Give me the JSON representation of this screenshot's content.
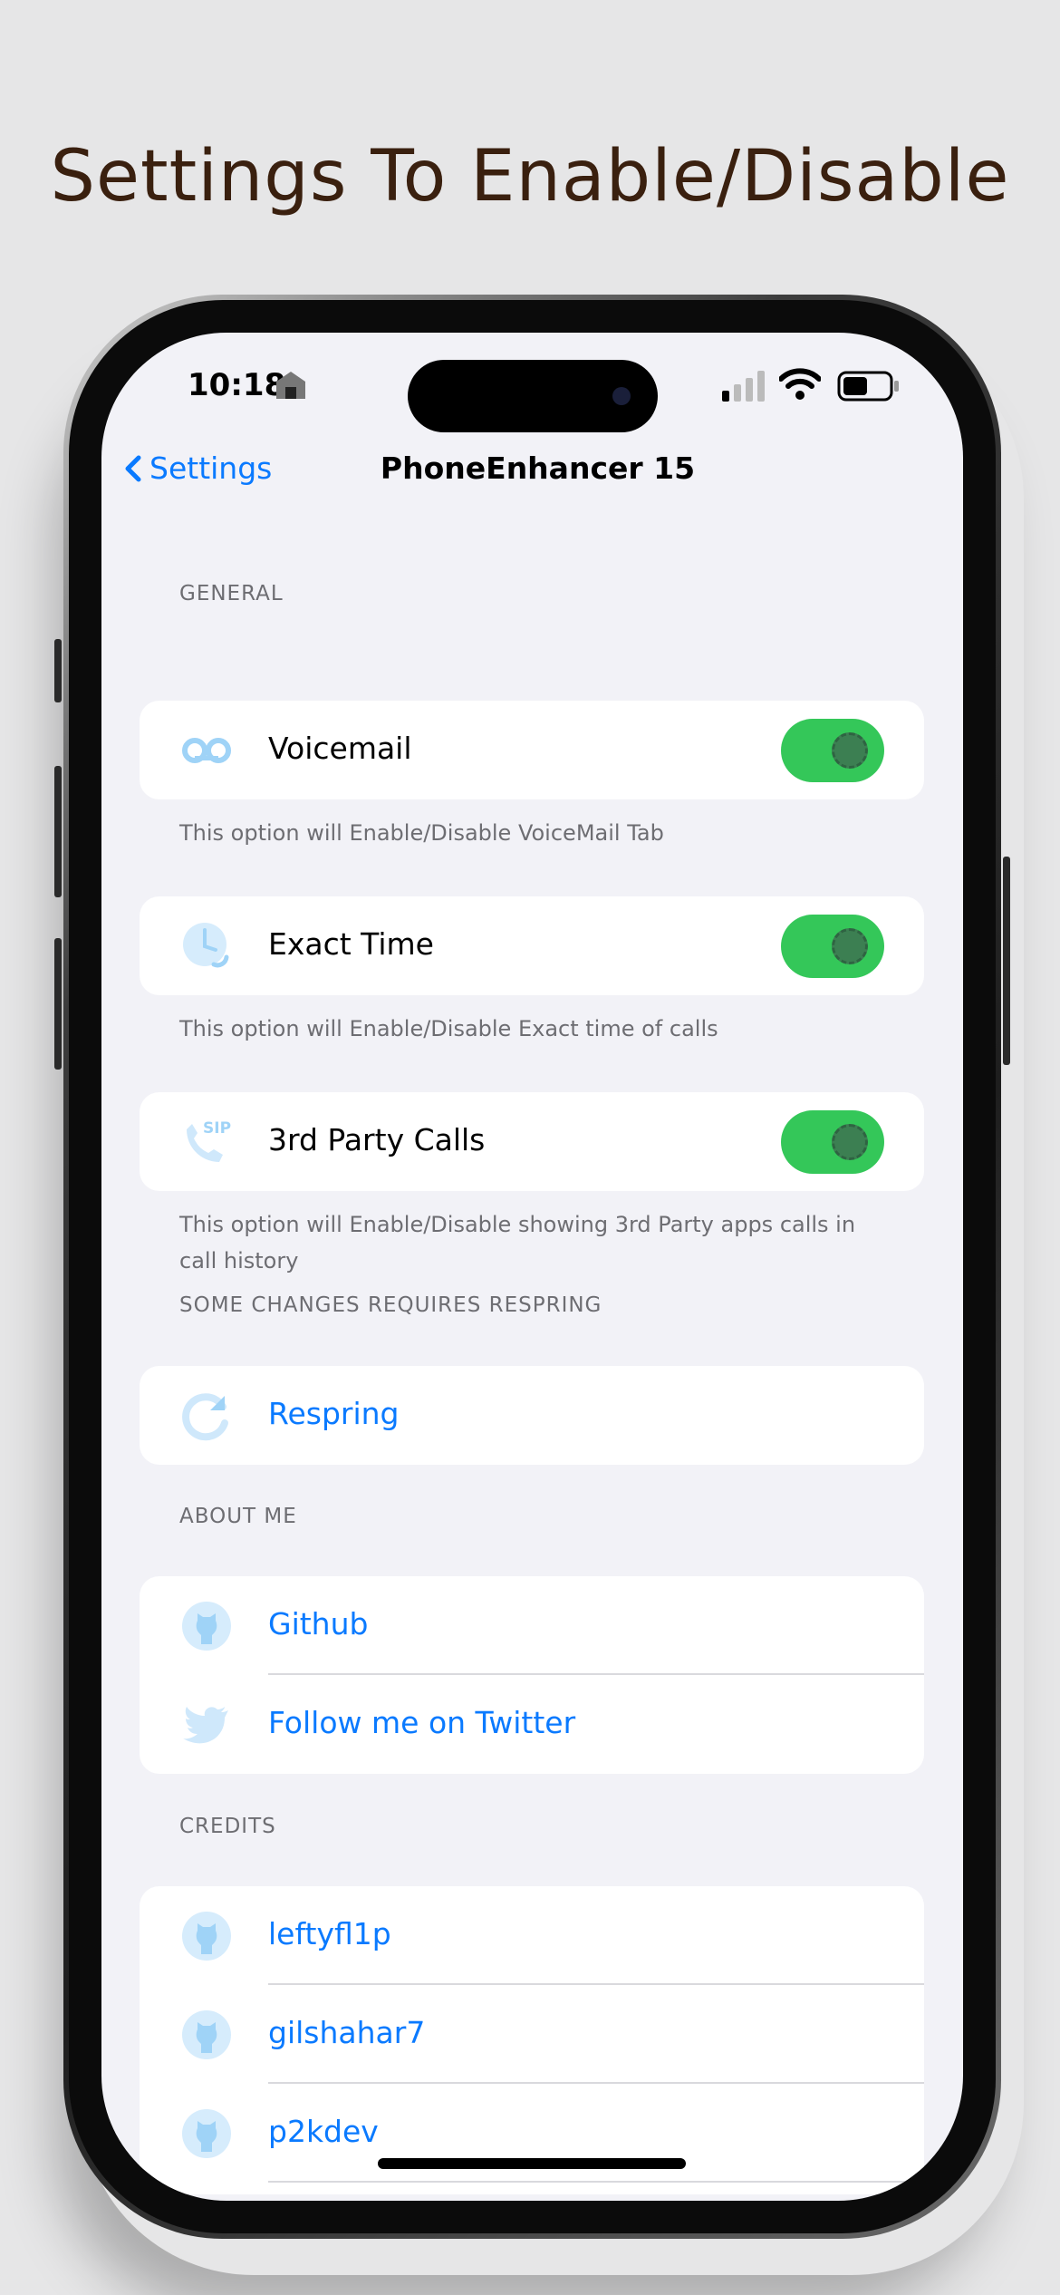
{
  "headline": "Settings To Enable/Disable",
  "status_bar": {
    "time": "10:18"
  },
  "nav": {
    "back_label": "Settings",
    "title": "PhoneEnhancer 15"
  },
  "general": {
    "header": "GENERAL",
    "items": [
      {
        "label": "Voicemail",
        "icon": "voicemail-icon",
        "toggle_on": true,
        "footnote": "This option will Enable/Disable VoiceMail Tab"
      },
      {
        "label": "Exact Time",
        "icon": "clock-icon",
        "toggle_on": true,
        "footnote": "This option will Enable/Disable Exact time of calls"
      },
      {
        "label": "3rd Party Calls",
        "icon": "sip-phone-icon",
        "toggle_on": true,
        "footnote": "This option will Enable/Disable showing 3rd Party apps calls in call history"
      }
    ]
  },
  "respring": {
    "header": "SOME CHANGES REQUIRES RESPRING",
    "label": "Respring",
    "icon": "refresh-icon"
  },
  "about": {
    "header": "ABOUT ME",
    "items": [
      {
        "label": "Github",
        "icon": "github-icon"
      },
      {
        "label": "Follow me on Twitter",
        "icon": "twitter-icon"
      }
    ]
  },
  "credits": {
    "header": "CREDITS",
    "items": [
      {
        "label": "leftyfl1p",
        "icon": "github-icon"
      },
      {
        "label": "gilshahar7",
        "icon": "github-icon"
      },
      {
        "label": "p2kdev",
        "icon": "github-icon"
      }
    ]
  },
  "colors": {
    "accent": "#0a7aff",
    "toggle_on": "#34c759",
    "background": "#f2f2f7",
    "icon_tint": "#9fd3f7"
  }
}
